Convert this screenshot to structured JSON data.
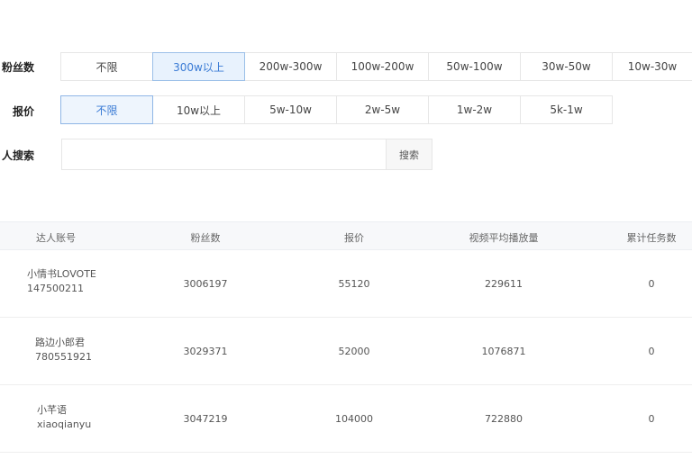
{
  "filters": {
    "fans": {
      "label": "粉丝数",
      "options": [
        "不限",
        "300w以上",
        "200w-300w",
        "100w-200w",
        "50w-100w",
        "30w-50w",
        "10w-30w"
      ],
      "selected_index": 1
    },
    "price": {
      "label": "报价",
      "options": [
        "不限",
        "10w以上",
        "5w-10w",
        "2w-5w",
        "1w-2w",
        "5k-1w"
      ],
      "selected_index": 0
    },
    "search": {
      "label": "人搜索",
      "value": "",
      "button": "搜索"
    }
  },
  "table": {
    "headers": [
      "达人账号",
      "粉丝数",
      "报价",
      "视频平均播放量",
      "累计任务数"
    ],
    "rows": [
      {
        "name": "小情书LOVOTE",
        "id": "147500211",
        "fans": "3006197",
        "price": "55120",
        "avg_views": "229611",
        "tasks": "0"
      },
      {
        "name": "路边小郎君",
        "id": "780551921",
        "fans": "3029371",
        "price": "52000",
        "avg_views": "1076871",
        "tasks": "0"
      },
      {
        "name": "小芊语",
        "id": "xiaoqianyu",
        "fans": "3047219",
        "price": "104000",
        "avg_views": "722880",
        "tasks": "0"
      }
    ]
  },
  "colors": {
    "selected_border": "#8fb6e6",
    "selected_text": "#3a7bd5",
    "header_bg": "#f7f8fa"
  }
}
